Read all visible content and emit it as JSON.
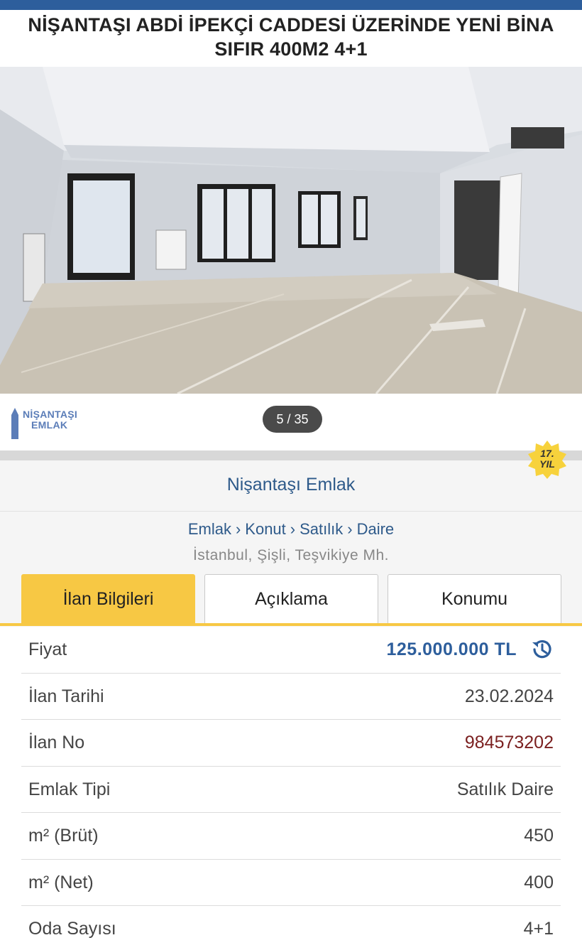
{
  "header": {
    "title": "NİŞANTAŞI ABDİ İPEKÇİ CADDESİ ÜZERİNDE YENİ BİNA SIFIR 400M2 4+1"
  },
  "gallery": {
    "counter": "5 / 35",
    "logo_line1": "NİŞANTAŞI",
    "logo_line2": "EMLAK"
  },
  "store": {
    "name": "Nişantaşı Emlak",
    "badge_years": "17.",
    "badge_label": "YIL"
  },
  "breadcrumb": {
    "items": [
      "Emlak",
      "Konut",
      "Satılık",
      "Daire"
    ],
    "separator": "›"
  },
  "location": "İstanbul, Şişli, Teşvikiye Mh.",
  "tabs": [
    {
      "label": "İlan Bilgileri",
      "active": true
    },
    {
      "label": "Açıklama",
      "active": false
    },
    {
      "label": "Konumu",
      "active": false
    }
  ],
  "details": [
    {
      "label": "Fiyat",
      "value": "125.000.000 TL"
    },
    {
      "label": "İlan Tarihi",
      "value": "23.02.2024"
    },
    {
      "label": "İlan No",
      "value": "984573202"
    },
    {
      "label": "Emlak Tipi",
      "value": "Satılık Daire"
    },
    {
      "label": "m² (Brüt)",
      "value": "450"
    },
    {
      "label": "m² (Net)",
      "value": "400"
    },
    {
      "label": "Oda Sayısı",
      "value": "4+1"
    }
  ],
  "icons": {
    "price_history": "history-icon",
    "logo": "building-icon"
  },
  "colors": {
    "brand_blue": "#2d5e9c",
    "active_tab": "#f7c844",
    "listing_no": "#7a1f1f"
  }
}
